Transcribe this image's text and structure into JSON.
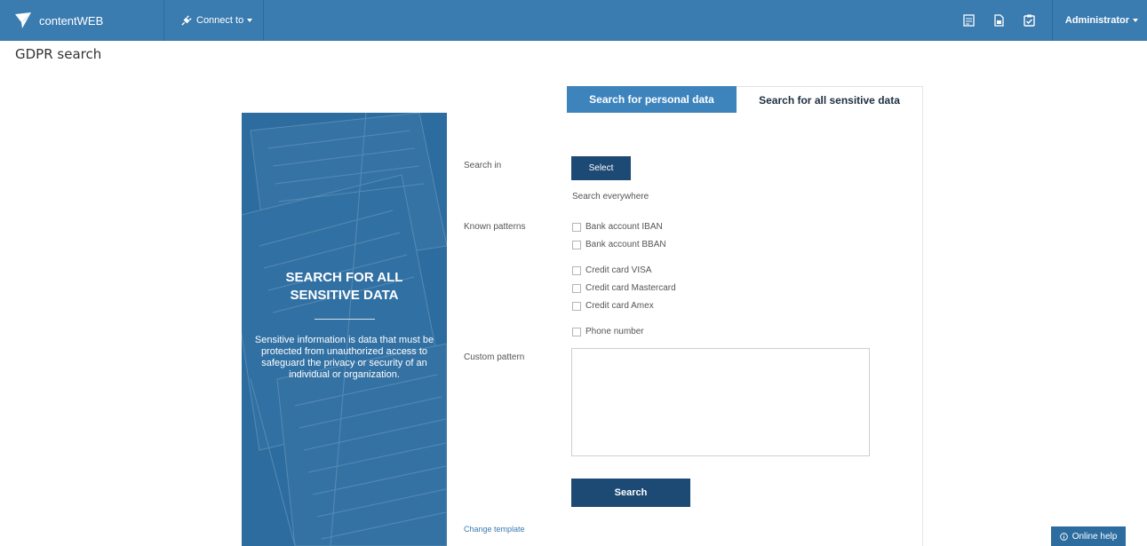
{
  "navbar": {
    "brand": "contentWEB",
    "connect_label": "Connect to",
    "icons": [
      "report-icon",
      "document-icon",
      "clipboard-check-icon"
    ],
    "user": "Administrator"
  },
  "page": {
    "title": "GDPR search"
  },
  "tabs": [
    {
      "label": "Search for personal data",
      "active": false
    },
    {
      "label": "Search for all sensitive data",
      "active": true
    }
  ],
  "hero": {
    "title_line1": "SEARCH FOR ALL",
    "title_line2": "SENSITIVE DATA",
    "description": "Sensitive information is data that must be protected from unauthorized access to safeguard the privacy or security of an individual or organization."
  },
  "form": {
    "search_in_label": "Search in",
    "select_button": "Select",
    "search_in_value": "Search everywhere",
    "known_patterns_label": "Known patterns",
    "patterns": [
      {
        "label": "Bank account IBAN",
        "checked": false
      },
      {
        "label": "Bank account BBAN",
        "checked": false
      },
      {
        "label": "Credit card VISA",
        "checked": false
      },
      {
        "label": "Credit card Mastercard",
        "checked": false
      },
      {
        "label": "Credit card Amex",
        "checked": false
      },
      {
        "label": "Phone number",
        "checked": false
      }
    ],
    "custom_pattern_label": "Custom pattern",
    "custom_pattern_value": "",
    "search_button": "Search",
    "change_template": "Change template"
  },
  "footer": {
    "online_help": "Online help"
  },
  "colors": {
    "navbar": "#3a7bb0",
    "button": "#1d4a74",
    "tab_active_bg": "#3d84bd"
  }
}
